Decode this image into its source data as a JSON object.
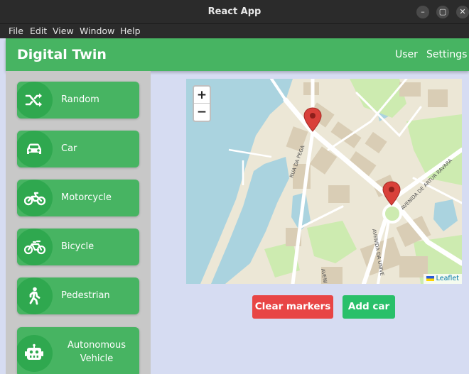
{
  "window": {
    "title": "React App"
  },
  "menu": [
    "File",
    "Edit",
    "View",
    "Window",
    "Help"
  ],
  "header": {
    "brand": "Digital Twin",
    "nav": [
      "User",
      "Settings"
    ]
  },
  "sidebar": {
    "items": [
      {
        "label": "Random",
        "icon": "shuffle-icon"
      },
      {
        "label": "Car",
        "icon": "car-icon"
      },
      {
        "label": "Motorcycle",
        "icon": "motorcycle-icon"
      },
      {
        "label": "Bicycle",
        "icon": "bicycle-icon"
      },
      {
        "label": "Pedestrian",
        "icon": "pedestrian-icon"
      },
      {
        "label": "Autonomous Vehicle",
        "icon": "robot-icon"
      }
    ]
  },
  "map": {
    "zoom_in": "+",
    "zoom_out": "−",
    "attribution": "Leaflet",
    "street_labels": [
      "RUA DA PEGA",
      "AVENIDA DE ARTUR RAVARA",
      "AVENIDA DA UNIVE",
      "AVENI"
    ]
  },
  "actions": {
    "clear": "Clear markers",
    "add": "Add car"
  },
  "colors": {
    "header": "#47b462",
    "clear": "#e84545",
    "add": "#29c06a",
    "marker": "#d9403a",
    "water": "#aad3df"
  }
}
